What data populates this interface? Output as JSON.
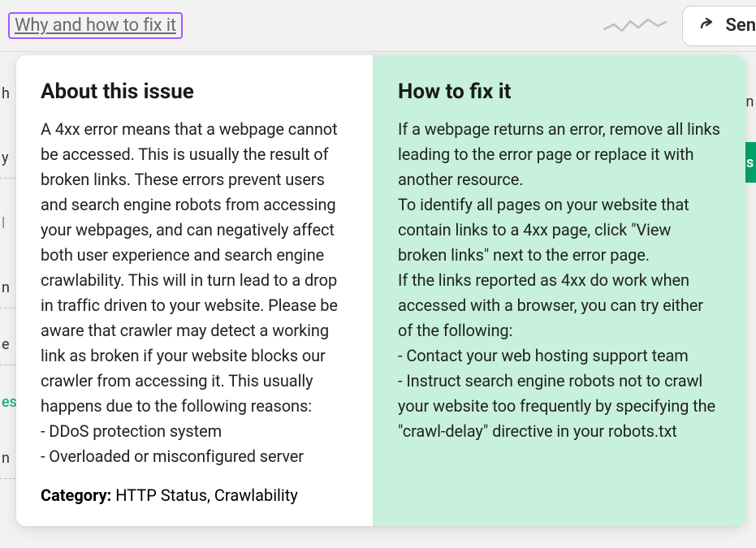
{
  "topbar": {
    "link_label": "Why and how to fix it",
    "button_label": "Sen"
  },
  "popover": {
    "left": {
      "heading": "About this issue",
      "body": "A 4xx error means that a webpage cannot be accessed. This is usually the result of broken links. These errors prevent users and search engine robots from accessing your webpages, and can negatively affect both user experience and search engine crawlability. This will in turn lead to a drop in traffic driven to your website. Please be aware that crawler may detect a working link as broken if your website blocks our crawler from accessing it. This usually happens due to the following reasons:\n- DDoS protection system\n- Overloaded or misconfigured server",
      "category_label": "Category:",
      "category_value": " HTTP Status, Crawlability"
    },
    "right": {
      "heading": "How to fix it",
      "body": "If a webpage returns an error, remove all links leading to the error page or replace it with another resource.\nTo identify all pages on your website that contain links to a 4xx page, click \"View broken links\" next to the error page.\nIf the links reported as 4xx do work when accessed with a browser, you can try either of the following:\n- Contact your web hosting support team\n- Instruct search engine robots not to crawl your website too frequently by specifying the \"crawl-delay\" directive in your robots.txt"
    }
  },
  "bg_rows": {
    "r1": "h",
    "r2": "y",
    "r3": "l",
    "r4": "n",
    "r5": "e",
    "r6": "es",
    "r7": "n",
    "right1": "en",
    "right2": "us"
  }
}
